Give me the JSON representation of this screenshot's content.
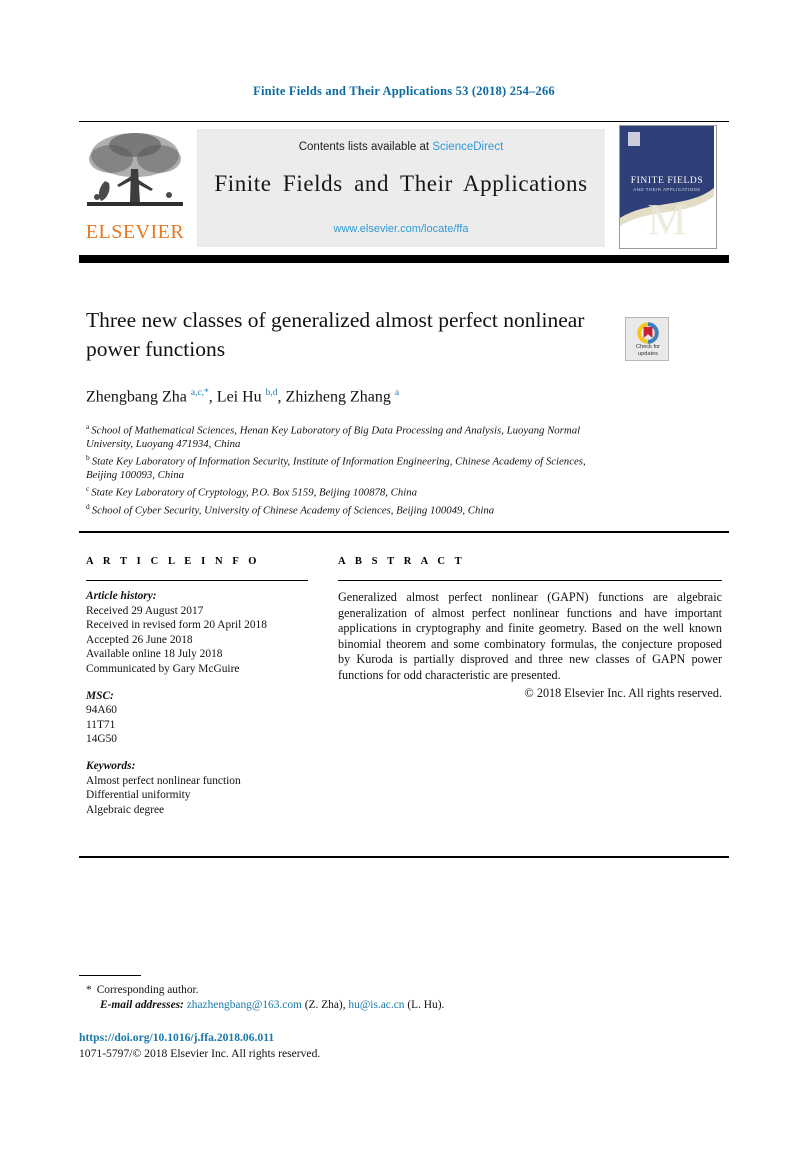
{
  "running_head": "Finite Fields and Their Applications 53 (2018) 254–266",
  "masthead": {
    "contents_prefix": "Contents lists available at",
    "contents_link": "ScienceDirect",
    "journal_title": "Finite Fields and Their Applications",
    "journal_url": "www.elsevier.com/locate/ffa",
    "publisher": "ELSEVIER",
    "cover_title_line1": "FINITE FIELDS",
    "cover_title_line2": "AND THEIR APPLICATIONS",
    "accent_link_color": "#2e9bd6",
    "publisher_color": "#e87722"
  },
  "article": {
    "title": "Three new classes of generalized almost perfect nonlinear power functions",
    "crossmark": {
      "label_line1": "Check for",
      "label_line2": "updates"
    },
    "authors_html": "Zhengbang Zha <sup>a,c,*</sup>, Lei Hu <sup>b,d</sup>, Zhizheng Zhang <sup>a</sup>",
    "affiliations": [
      {
        "marker": "a",
        "text": "School of Mathematical Sciences, Henan Key Laboratory of Big Data Processing and Analysis, Luoyang Normal University, Luoyang 471934, China"
      },
      {
        "marker": "b",
        "text": "State Key Laboratory of Information Security, Institute of Information Engineering, Chinese Academy of Sciences, Beijing 100093, China"
      },
      {
        "marker": "c",
        "text": "State Key Laboratory of Cryptology, P.O. Box 5159, Beijing 100878, China"
      },
      {
        "marker": "d",
        "text": "School of Cyber Security, University of Chinese Academy of Sciences, Beijing 100049, China"
      }
    ]
  },
  "info": {
    "heading": "A R T I C L E   I N F O",
    "history_label": "Article history:",
    "history_lines": [
      "Received 29 August 2017",
      "Received in revised form 20 April 2018",
      "Accepted 26 June 2018",
      "Available online 18 July 2018",
      "Communicated by Gary McGuire"
    ],
    "msc_label": "MSC:",
    "msc_codes": [
      "94A60",
      "11T71",
      "14G50"
    ],
    "keywords_label": "Keywords:",
    "keywords": [
      "Almost perfect nonlinear function",
      "Differential uniformity",
      "Algebraic degree"
    ]
  },
  "abstract": {
    "heading": "A B S T R A C T",
    "text": "Generalized almost perfect nonlinear (GAPN) functions are algebraic generalization of almost perfect nonlinear functions and have important applications in cryptography and finite geometry. Based on the well known binomial theorem and some combinatory formulas, the conjecture proposed by Kuroda is partially disproved and three new classes of GAPN power functions for odd characteristic are presented.",
    "rights": "© 2018 Elsevier Inc. All rights reserved."
  },
  "footer": {
    "corresponding_marker": "*",
    "corresponding_text": "Corresponding author.",
    "email_label": "E-mail addresses:",
    "email_1": "zhazhengbang@163.com",
    "email_1_owner": "(Z. Zha),",
    "email_2": "hu@is.ac.cn",
    "email_2_owner": "(L. Hu).",
    "doi": "https://doi.org/10.1016/j.ffa.2018.06.011",
    "issn_line": "1071-5797/© 2018 Elsevier Inc. All rights reserved."
  }
}
